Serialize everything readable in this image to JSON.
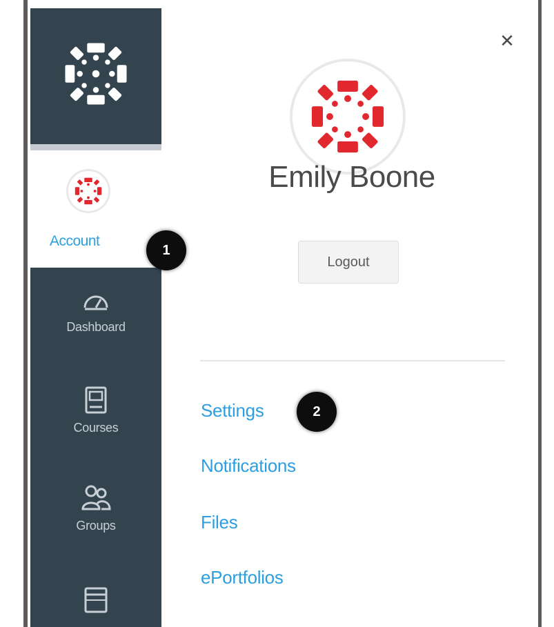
{
  "nav": {
    "account_label": "Account",
    "items": [
      {
        "label": "Dashboard",
        "icon": "dashboard-icon"
      },
      {
        "label": "Courses",
        "icon": "courses-icon"
      },
      {
        "label": "Groups",
        "icon": "groups-icon"
      },
      {
        "label": "",
        "icon": "calendar-icon"
      }
    ]
  },
  "callouts": {
    "account": "1",
    "settings": "2"
  },
  "tray": {
    "user_name": "Emily Boone",
    "logout_label": "Logout",
    "links": [
      "Settings",
      "Notifications",
      "Files",
      "ePortfolios"
    ]
  },
  "colors": {
    "nav_bg": "#34444f",
    "link": "#2d9ee0",
    "avatar_red": "#e0282e",
    "callout": "#0d0d0d"
  }
}
